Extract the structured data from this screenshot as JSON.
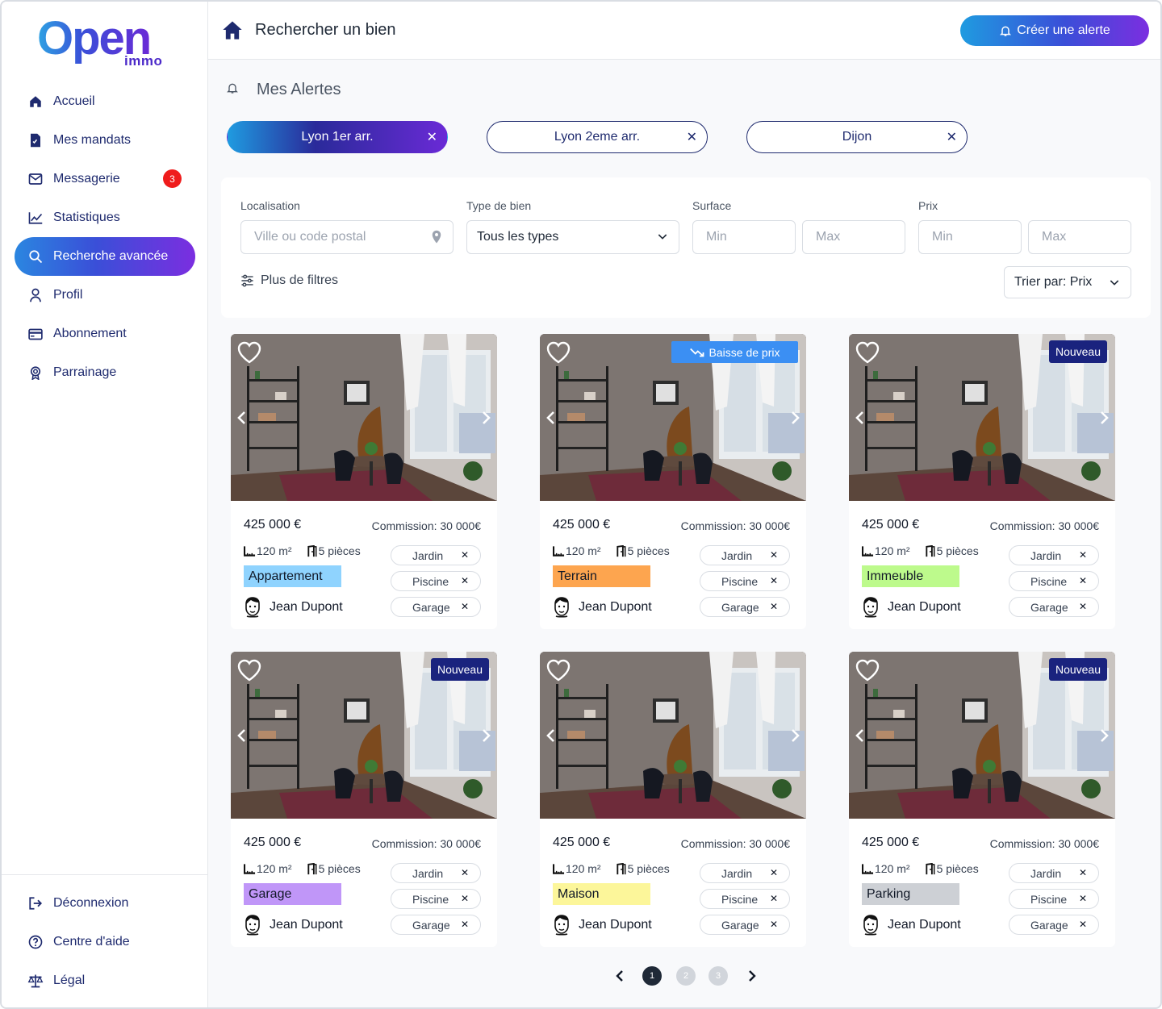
{
  "brand": {
    "logo_main": "Open",
    "logo_sub": "immo"
  },
  "sidebar": {
    "items": [
      {
        "label": "Accueil",
        "icon": "home-icon"
      },
      {
        "label": "Mes mandats",
        "icon": "document-icon"
      },
      {
        "label": "Messagerie",
        "icon": "mail-icon",
        "badge": "3"
      },
      {
        "label": "Statistiques",
        "icon": "chart-icon"
      },
      {
        "label": "Recherche avancée",
        "icon": "search-icon",
        "active": true
      },
      {
        "label": "Profil",
        "icon": "user-icon"
      },
      {
        "label": "Abonnement",
        "icon": "credit-card-icon"
      },
      {
        "label": "Parrainage",
        "icon": "award-icon"
      }
    ],
    "bottom": [
      {
        "label": "Déconnexion",
        "icon": "logout-icon"
      },
      {
        "label": "Centre d'aide",
        "icon": "help-icon"
      },
      {
        "label": "Légal",
        "icon": "scale-icon"
      }
    ]
  },
  "header": {
    "title": "Rechercher un bien",
    "alert_button": "Créer une alerte"
  },
  "alerts": {
    "title": "Mes Alertes",
    "chips": [
      {
        "label": "Lyon 1er arr.",
        "active": true
      },
      {
        "label": "Lyon 2eme arr.",
        "active": false
      },
      {
        "label": "Dijon",
        "active": false
      }
    ],
    "remove_symbol": "✕"
  },
  "filters": {
    "location_label": "Localisation",
    "location_placeholder": "Ville ou code postal",
    "type_label": "Type de bien",
    "type_value": "Tous les types",
    "surface_label": "Surface",
    "price_label": "Prix",
    "min_placeholder": "Min",
    "max_placeholder": "Max",
    "more_filters": "Plus de filtres",
    "sort": "Trier par: Prix"
  },
  "listings": [
    {
      "price": "425 000 €",
      "commission": "Commission: 30 000€",
      "surface": "120 m²",
      "rooms": "5 pièces",
      "type": "Appartement",
      "type_color": "#8fd3fe",
      "agent": "Jean Dupont",
      "badge": "",
      "amenities": [
        "Jardin",
        "Piscine",
        "Garage"
      ]
    },
    {
      "price": "425 000 €",
      "commission": "Commission: 30 000€",
      "surface": "120 m²",
      "rooms": "5 pièces",
      "type": "Terrain",
      "type_color": "#fda54f",
      "agent": "Jean Dupont",
      "badge": "Baisse de prix",
      "amenities": [
        "Jardin",
        "Piscine",
        "Garage"
      ]
    },
    {
      "price": "425 000 €",
      "commission": "Commission: 30 000€",
      "surface": "120 m²",
      "rooms": "5 pièces",
      "type": "Immeuble",
      "type_color": "#bdfa8c",
      "agent": "Jean Dupont",
      "badge": "Nouveau",
      "amenities": [
        "Jardin",
        "Piscine",
        "Garage"
      ]
    },
    {
      "price": "425 000 €",
      "commission": "Commission: 30 000€",
      "surface": "120 m²",
      "rooms": "5 pièces",
      "type": "Garage",
      "type_color": "#c096f8",
      "agent": "Jean Dupont",
      "badge": "Nouveau",
      "amenities": [
        "Jardin",
        "Piscine",
        "Garage"
      ]
    },
    {
      "price": "425 000 €",
      "commission": "Commission: 30 000€",
      "surface": "120 m²",
      "rooms": "5 pièces",
      "type": "Maison",
      "type_color": "#fcf69a",
      "agent": "Jean Dupont",
      "badge": "",
      "amenities": [
        "Jardin",
        "Piscine",
        "Garage"
      ]
    },
    {
      "price": "425 000 €",
      "commission": "Commission: 30 000€",
      "surface": "120 m²",
      "rooms": "5 pièces",
      "type": "Parking",
      "type_color": "#cdd0d5",
      "agent": "Jean Dupont",
      "badge": "Nouveau",
      "amenities": [
        "Jardin",
        "Piscine",
        "Garage"
      ]
    }
  ],
  "pagination": {
    "pages": [
      "1",
      "2",
      "3"
    ],
    "current": "1"
  }
}
